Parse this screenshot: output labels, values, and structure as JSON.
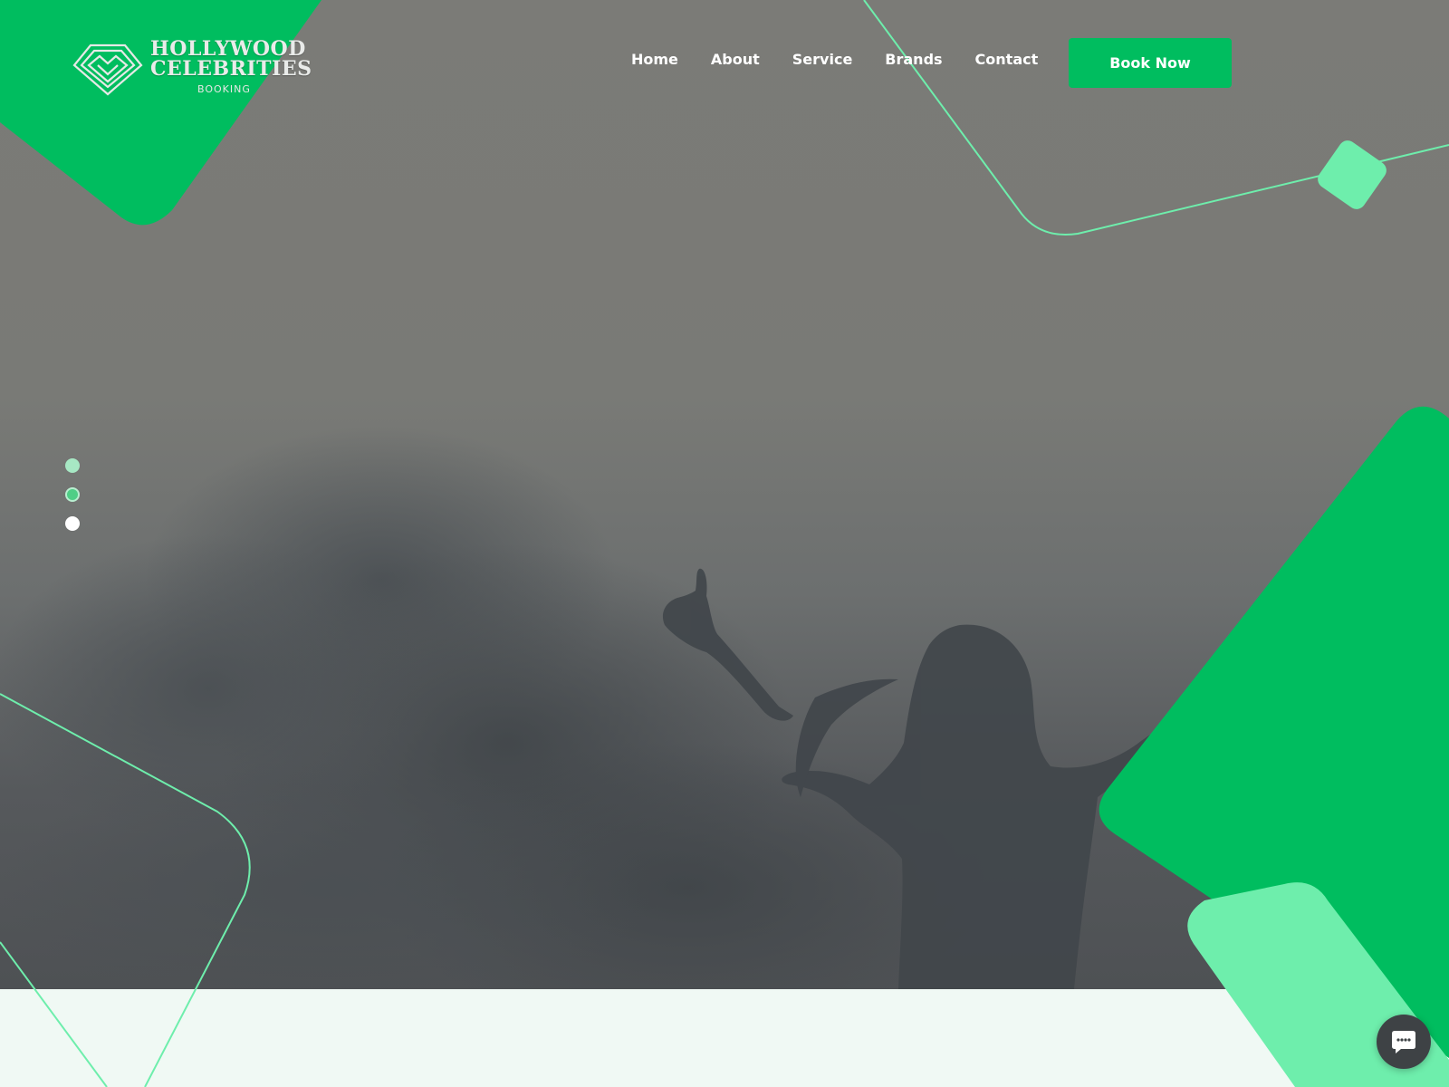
{
  "brand": {
    "name_line1": "HOLLYWOOD",
    "name_line2": "CELEBRITIES",
    "tagline": "BOOKING",
    "logo_icon": "diamond-heart-logo-icon"
  },
  "nav": {
    "items": [
      {
        "label": "Home"
      },
      {
        "label": "About"
      },
      {
        "label": "Service"
      },
      {
        "label": "Brands"
      },
      {
        "label": "Contact"
      }
    ],
    "cta_label": "Book Now"
  },
  "slider": {
    "total_slides": 3,
    "active_index": 1
  },
  "chat": {
    "icon": "chat-bubble-icon"
  },
  "colors": {
    "accent_green": "#00bd5f",
    "light_green": "#6eeeac",
    "footer_band": "#f0f9f4",
    "text_white": "#ffffff",
    "chat_button": "#3e4245"
  }
}
